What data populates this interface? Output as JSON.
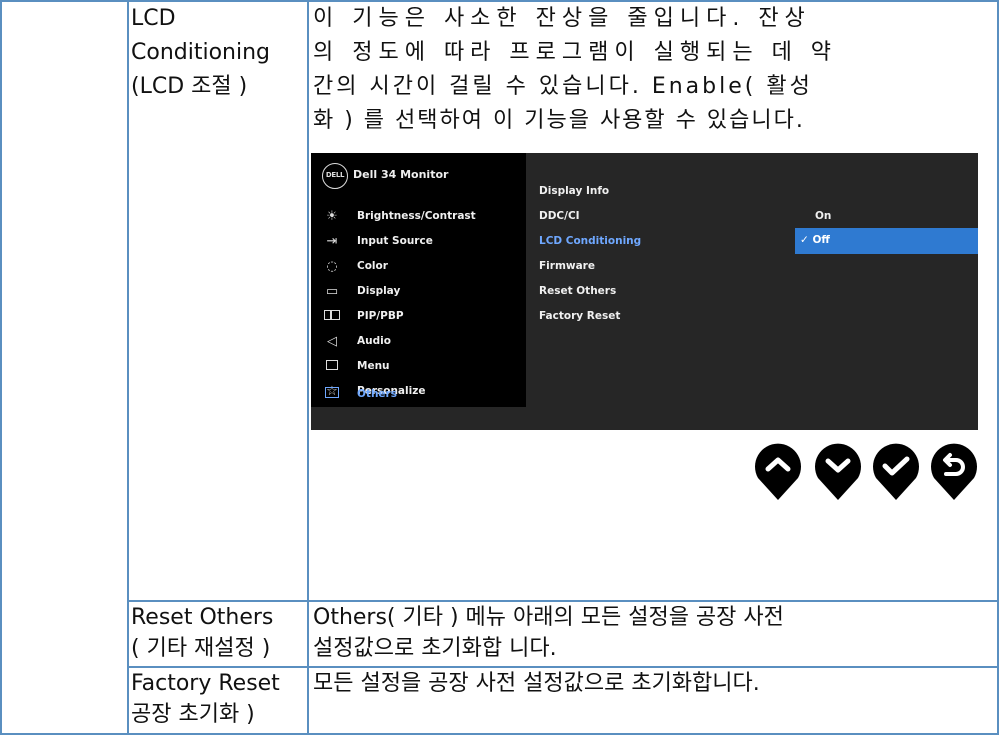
{
  "rows": [
    {
      "label_lines": [
        "LCD",
        "Conditioning",
        "(LCD 조절 )"
      ],
      "desc_lines": [
        "이 기능은 사소한 잔상을 줄입니다. 잔상",
        "의 정도에 따라 프로그램이 실행되는 데 약",
        "간의 시간이 걸릴 수 있습니다. Enable( 활성",
        "화 ) 를 선택하여 이 기능을 사용할 수 있습니다."
      ]
    },
    {
      "label_lines": [
        "Reset Others",
        "( 기타 재설정 )"
      ],
      "desc_lines": [
        "Others( 기타 ) 메뉴 아래의 모든 설정을 공장 사전",
        "설정값으로 초기화합 니다."
      ]
    },
    {
      "label_lines": [
        "Factory Reset",
        "공장 초기화 )"
      ],
      "desc_lines": [
        "모든 설정을 공장 사전 설정값으로 초기화합니다."
      ]
    }
  ],
  "osd": {
    "logo": "DELL",
    "model": "Dell 34 Monitor",
    "menu": [
      {
        "label": "Brightness/Contrast",
        "icon": "brightness-icon"
      },
      {
        "label": "Input Source",
        "icon": "input-source-icon"
      },
      {
        "label": "Color",
        "icon": "color-palette-icon"
      },
      {
        "label": "Display",
        "icon": "display-monitor-icon"
      },
      {
        "label": "PIP/PBP",
        "icon": "pip-pbp-icon"
      },
      {
        "label": "Audio",
        "icon": "audio-speaker-icon"
      },
      {
        "label": "Menu",
        "icon": "menu-icon"
      },
      {
        "label": "Personalize",
        "icon": "star-icon"
      },
      {
        "label": "Others",
        "icon": "others-icon"
      }
    ],
    "active_menu": "Others",
    "submenu": [
      "Display Info",
      "DDC/CI",
      "LCD Conditioning",
      "Firmware",
      "Reset Others",
      "Factory Reset"
    ],
    "highlighted_submenu": "LCD Conditioning",
    "ddc_value": "On",
    "lcd_value": "✓ Off"
  },
  "nav_buttons": [
    "up-button",
    "down-button",
    "confirm-button",
    "back-button"
  ],
  "colors": {
    "border": "#5a8fc0",
    "highlight": "#2f7ad1",
    "active_text": "#6fa8ff"
  }
}
